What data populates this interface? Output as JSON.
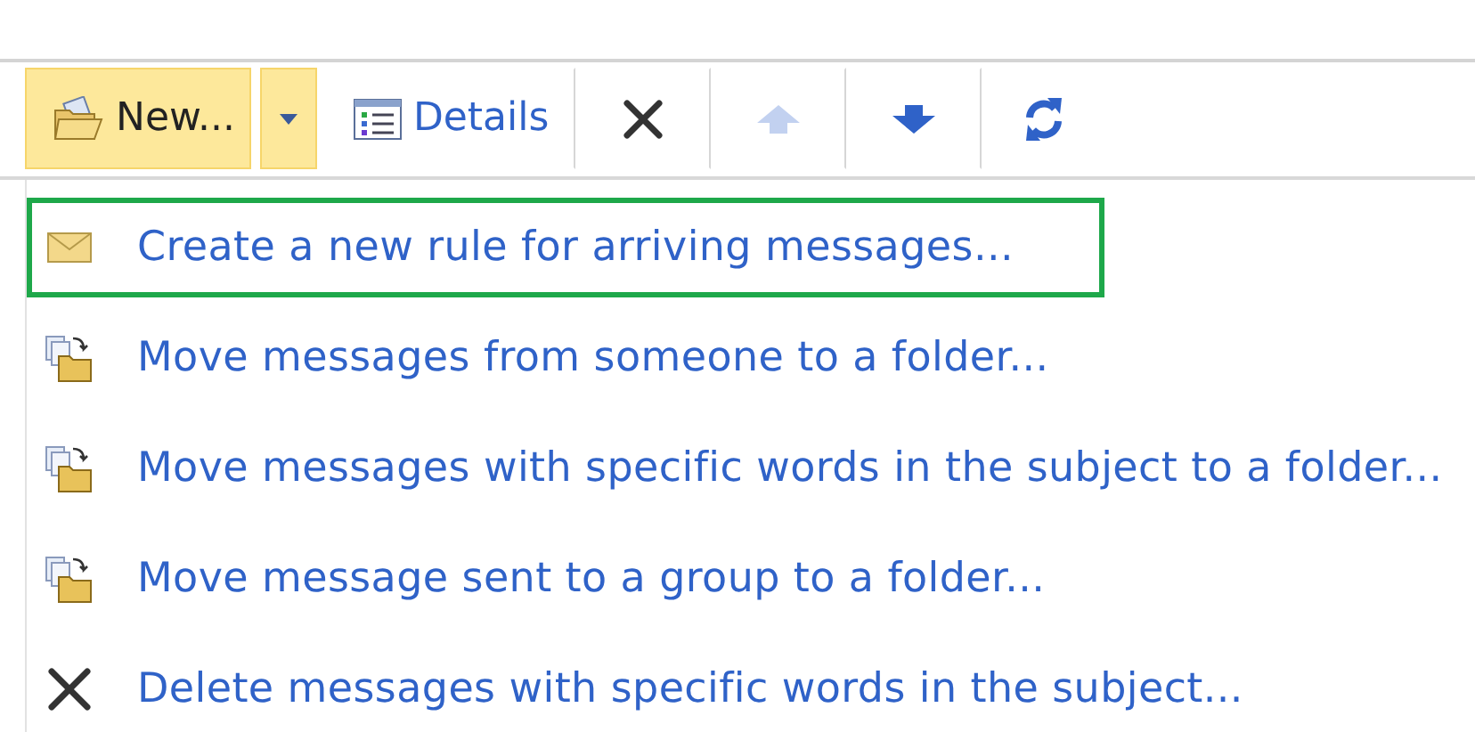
{
  "toolbar": [
    {
      "kind": "new",
      "label": "New...",
      "highlighted": true,
      "disabled": false
    },
    {
      "kind": "dropdown",
      "highlighted": true,
      "disabled": false
    },
    {
      "kind": "details",
      "label": "Details",
      "highlighted": false,
      "disabled": false
    },
    {
      "kind": "delete",
      "highlighted": false,
      "disabled": false
    },
    {
      "kind": "up",
      "highlighted": false,
      "disabled": true
    },
    {
      "kind": "down",
      "highlighted": false,
      "disabled": false
    },
    {
      "kind": "refresh",
      "highlighted": false,
      "disabled": false
    }
  ],
  "menu": [
    {
      "kind": "envelope",
      "label": "Create a new rule for arriving messages...",
      "selected": true
    },
    {
      "kind": "move",
      "label": "Move messages from someone to a folder...",
      "selected": false
    },
    {
      "kind": "move",
      "label": "Move messages with specific words in the subject to a folder...",
      "selected": false
    },
    {
      "kind": "move",
      "label": "Move message sent to a group to a folder...",
      "selected": false
    },
    {
      "kind": "delete",
      "label": "Delete messages with specific words in the subject...",
      "selected": false
    }
  ]
}
